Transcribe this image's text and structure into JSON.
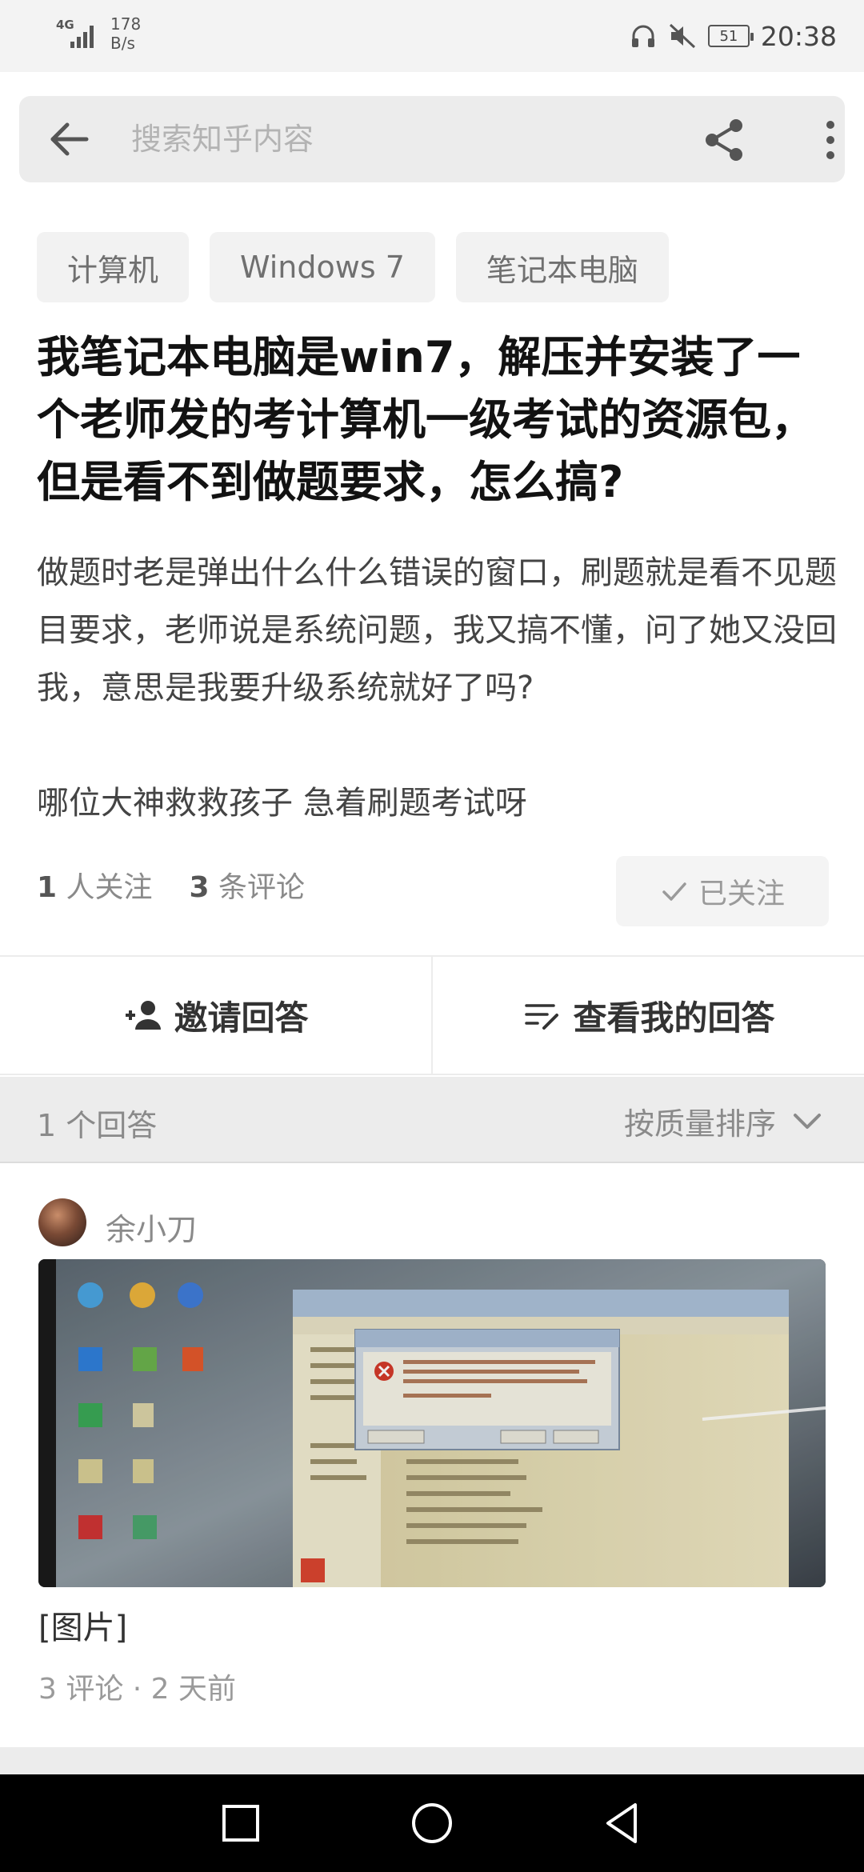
{
  "status_bar": {
    "network": "4G",
    "speed_value": "178",
    "speed_unit": "B/s",
    "battery": "51",
    "time": "20:38"
  },
  "search": {
    "placeholder": "搜索知乎内容"
  },
  "tags": [
    "计算机",
    "Windows 7",
    "笔记本电脑"
  ],
  "question": {
    "title": "我笔记本电脑是win7，解压并安装了一个老师发的考计算机一级考试的资源包，但是看不到做题要求，怎么搞?",
    "body_p1": "做题时老是弹出什么什么错误的窗口，刷题就是看不见题目要求，老师说是系统问题，我又搞不懂，问了她又没回我，意思是我要升级系统就好了吗?",
    "body_p2": "哪位大神救救孩子 急着刷题考试呀",
    "followers_count": "1",
    "followers_label": " 人关注",
    "comments_count": "3",
    "comments_label": " 条评论",
    "follow_button": "已关注"
  },
  "actions": {
    "invite": "邀请回答",
    "my_answer": "查看我的回答"
  },
  "answers_header": {
    "count": "1 个回答",
    "sort": "按质量排序"
  },
  "answer": {
    "author": "余小刀",
    "image_caption": "[图片]",
    "meta": "3 评论 · 2 天前"
  },
  "colors": {
    "background": "#ffffff",
    "muted_text": "#8a8a8a",
    "title_text": "#121212",
    "section_bg": "#ececec"
  },
  "icons": [
    "back-arrow-icon",
    "share-icon",
    "more-vertical-icon",
    "check-icon",
    "add-person-icon",
    "edit-list-icon",
    "chevron-down-icon",
    "nav-recent-icon",
    "nav-home-icon",
    "nav-back-icon"
  ]
}
